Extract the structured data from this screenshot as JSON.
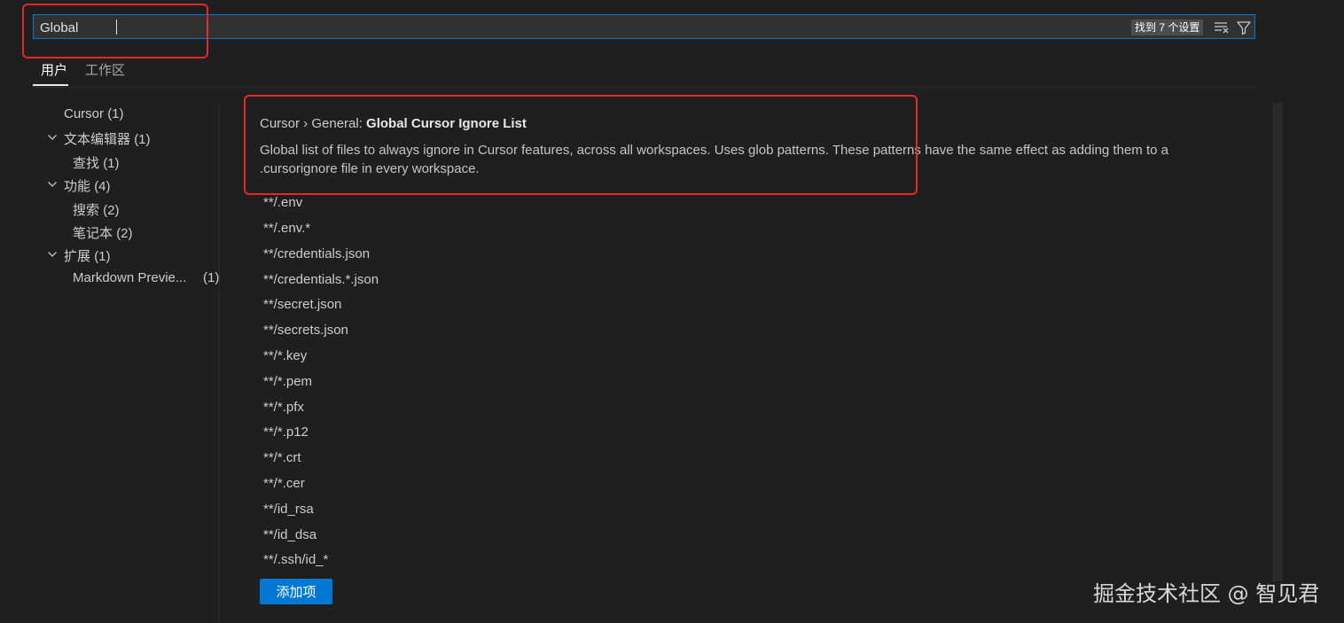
{
  "search": {
    "value": "Global",
    "result_count": "找到 7 个设置",
    "clear_icon": "clear-filter-icon",
    "filter_icon": "filter-icon"
  },
  "tabs": [
    {
      "label": "用户",
      "active": true
    },
    {
      "label": "工作区",
      "active": false
    }
  ],
  "tree": [
    {
      "label": "Cursor",
      "count": "(1)"
    },
    {
      "label": "文本编辑器",
      "count": "(1)"
    },
    {
      "label": "查找",
      "count": "(1)"
    },
    {
      "label": "功能",
      "count": "(4)"
    },
    {
      "label": "搜索",
      "count": "(2)"
    },
    {
      "label": "笔记本",
      "count": "(2)"
    },
    {
      "label": "扩展",
      "count": "(1)"
    },
    {
      "label": "Markdown Previe...",
      "count": "(1)"
    }
  ],
  "setting": {
    "prefix": "Cursor › General: ",
    "name": "Global Cursor Ignore List",
    "description": "Global list of files to always ignore in Cursor features, across all workspaces. Uses glob patterns. These patterns have the same effect as adding them to a .cursorignore file in every workspace.",
    "patterns": [
      "**/.env",
      "**/.env.*",
      "**/credentials.json",
      "**/credentials.*.json",
      "**/secret.json",
      "**/secrets.json",
      "**/*.key",
      "**/*.pem",
      "**/*.pfx",
      "**/*.p12",
      "**/*.crt",
      "**/*.cer",
      "**/id_rsa",
      "**/id_dsa",
      "**/.ssh/id_*"
    ],
    "add_button": "添加项"
  },
  "watermark": "掘金技术社区 @ 智见君",
  "colors": {
    "background": "#1f1f1f",
    "accent": "#0078d4",
    "annotation": "#e8262b"
  }
}
